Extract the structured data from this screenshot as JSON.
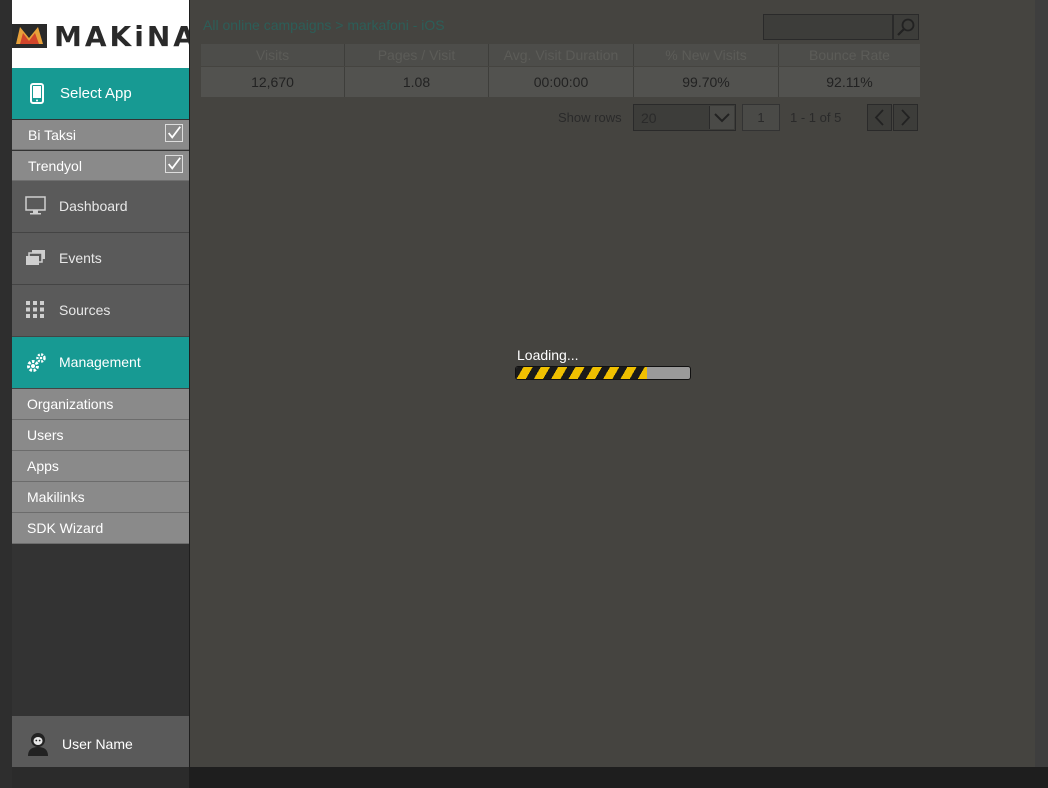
{
  "brand": {
    "logo_text": "MAKiNA",
    "accent_color": "#179a93"
  },
  "sidebar": {
    "select_app_label": "Select App",
    "apps": [
      {
        "label": "Bi Taksi",
        "checked": true
      },
      {
        "label": "Trendyol",
        "checked": true
      }
    ],
    "nav": [
      {
        "label": "Dashboard",
        "icon": "monitor-icon"
      },
      {
        "label": "Events",
        "icon": "stack-icon"
      },
      {
        "label": "Sources",
        "icon": "grid-icon"
      },
      {
        "label": "Management",
        "icon": "gears-icon",
        "active": true
      }
    ],
    "management_items": [
      {
        "label": "Organizations"
      },
      {
        "label": "Users"
      },
      {
        "label": "Apps"
      },
      {
        "label": "Makilinks"
      },
      {
        "label": "SDK Wizard"
      }
    ],
    "user_name": "User Name"
  },
  "main": {
    "breadcrumb": "All online campaigns > markafoni - iOS",
    "search": {
      "placeholder": ""
    },
    "table": {
      "columns": [
        "Visits",
        "Pages / Visit",
        "Avg. Visit Duration",
        "% New Visits",
        "Bounce Rate"
      ],
      "rows": [
        [
          "12,670",
          "1.08",
          "00:00:00",
          "99.70%",
          "92.11%"
        ]
      ]
    },
    "pager": {
      "show_rows_label": "Show rows",
      "rows_value": "20",
      "page": "1",
      "info": "1 - 1 of 5"
    },
    "loading": {
      "label": "Loading...",
      "progress": 0.75
    }
  }
}
